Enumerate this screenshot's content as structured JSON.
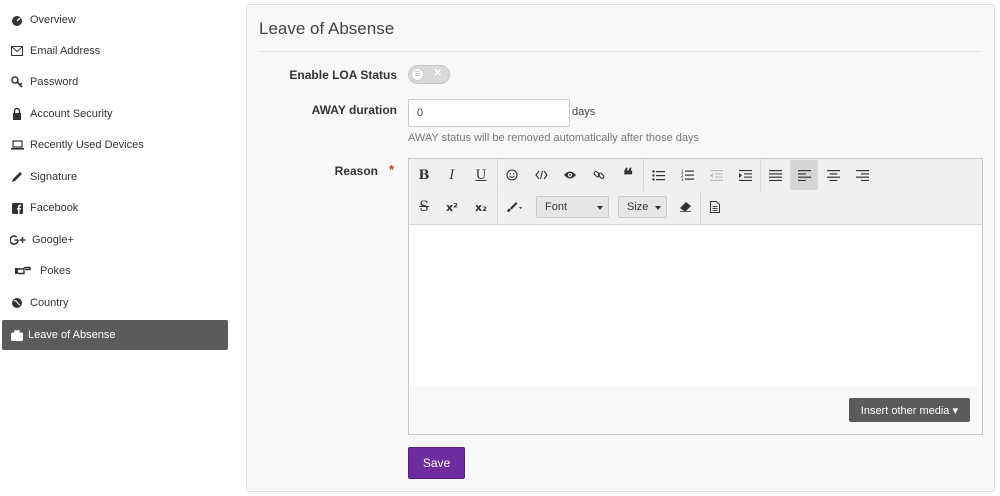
{
  "sidebar": {
    "items": [
      {
        "label": "Overview",
        "icon": "dashboard-icon"
      },
      {
        "label": "Email Address",
        "icon": "envelope-icon"
      },
      {
        "label": "Password",
        "icon": "key-icon"
      },
      {
        "label": "Account Security",
        "icon": "lock-icon"
      },
      {
        "label": "Recently Used Devices",
        "icon": "laptop-icon"
      },
      {
        "label": "Signature",
        "icon": "pencil-icon"
      },
      {
        "label": "Facebook",
        "icon": "facebook-icon"
      },
      {
        "label": "Google+",
        "icon": "google-plus-icon"
      },
      {
        "label": "Pokes",
        "icon": "hand-point-icon"
      },
      {
        "label": "Country",
        "icon": "globe-icon"
      },
      {
        "label": "Leave of Absense",
        "icon": "suitcase-icon",
        "active": true
      }
    ]
  },
  "panel": {
    "title": "Leave of Absense",
    "loa_label": "Enable LOA Status",
    "loa_enabled": false,
    "duration_label": "AWAY duration",
    "duration_value": "0",
    "duration_unit": "days",
    "duration_help": "AWAY status will be removed automatically after those days",
    "reason_label": "Reason",
    "required_mark": "*"
  },
  "editor": {
    "font_select": "Font",
    "size_select": "Size",
    "insert_media_label": "Insert other media ▾",
    "active_tool": "align-left"
  },
  "actions": {
    "save_label": "Save"
  },
  "colors": {
    "active_nav_bg": "#5b5b5b",
    "save_button": "#6e2c9e",
    "required": "#c0392b"
  }
}
